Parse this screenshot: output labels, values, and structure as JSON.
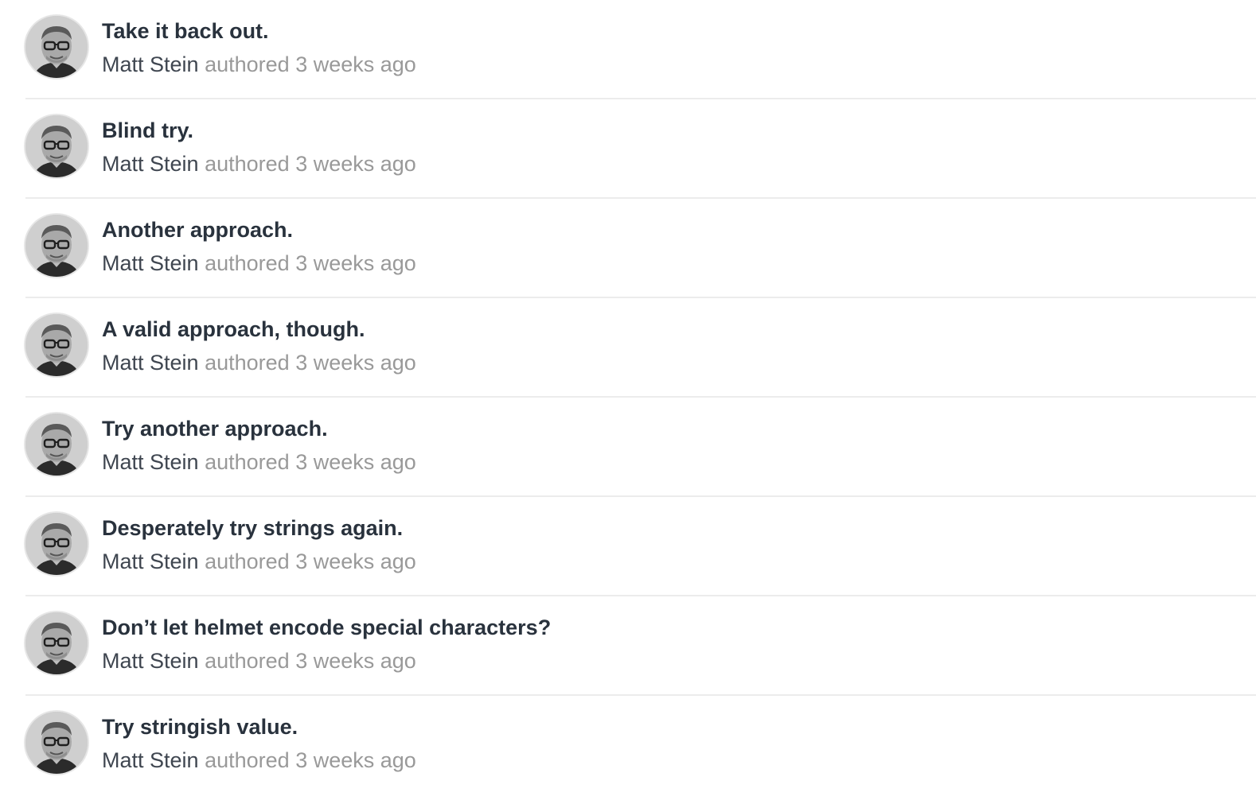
{
  "commits": [
    {
      "title": "Take it back out.",
      "author": "Matt Stein",
      "verb": "authored",
      "time": "3 weeks ago",
      "avatar_icon": "user-avatar-photo"
    },
    {
      "title": "Blind try.",
      "author": "Matt Stein",
      "verb": "authored",
      "time": "3 weeks ago",
      "avatar_icon": "user-avatar-photo"
    },
    {
      "title": "Another approach.",
      "author": "Matt Stein",
      "verb": "authored",
      "time": "3 weeks ago",
      "avatar_icon": "user-avatar-photo"
    },
    {
      "title": "A valid approach, though.",
      "author": "Matt Stein",
      "verb": "authored",
      "time": "3 weeks ago",
      "avatar_icon": "user-avatar-photo"
    },
    {
      "title": "Try another approach.",
      "author": "Matt Stein",
      "verb": "authored",
      "time": "3 weeks ago",
      "avatar_icon": "user-avatar-photo"
    },
    {
      "title": "Desperately try strings again.",
      "author": "Matt Stein",
      "verb": "authored",
      "time": "3 weeks ago",
      "avatar_icon": "user-avatar-photo"
    },
    {
      "title": "Don’t let helmet encode special characters?",
      "author": "Matt Stein",
      "verb": "authored",
      "time": "3 weeks ago",
      "avatar_icon": "user-avatar-photo"
    },
    {
      "title": "Try stringish value.",
      "author": "Matt Stein",
      "verb": "authored",
      "time": "3 weeks ago",
      "avatar_icon": "user-avatar-photo"
    }
  ],
  "colors": {
    "title": "#29323d",
    "author": "#3f4650",
    "meta": "#999999",
    "divider": "#ececec"
  }
}
